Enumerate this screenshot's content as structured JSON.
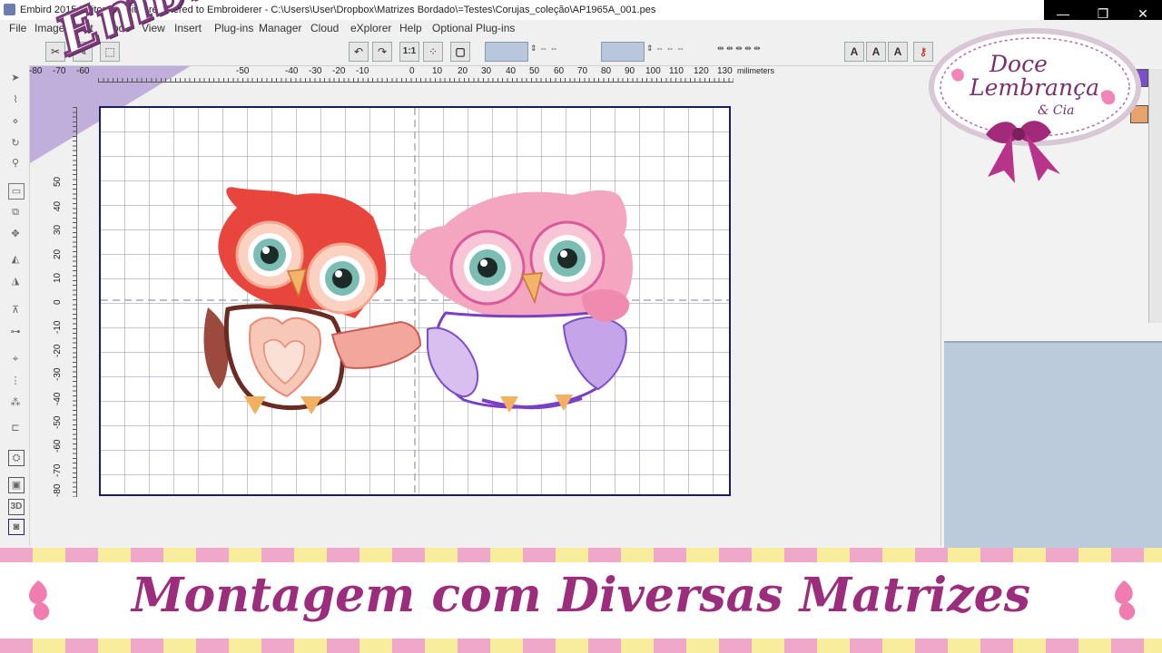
{
  "window": {
    "title": "Embird 2015 Editor (32-bit) - registered to Embroiderer - C:\\Users\\User\\Dropbox\\Matrizes Bordado\\=Testes\\Corujas_coleção\\AP1965A_001.pes",
    "controls": {
      "minimize": "—",
      "maximize": "❐",
      "close": "✕"
    }
  },
  "menu": [
    "File",
    "Image",
    "Edit",
    "Mode",
    "View",
    "Insert",
    "Plug-ins",
    "Manager",
    "Cloud",
    "eXplorer",
    "Help",
    "Optional Plug-ins"
  ],
  "toolbar": {
    "zoom_1to1": "1:1",
    "text_tools": [
      "A",
      "A",
      "A"
    ]
  },
  "ruler": {
    "h_labels": [
      "-80",
      "-70",
      "-60",
      "-50",
      "-40",
      "-30",
      "-20",
      "-10",
      "0",
      "10",
      "20",
      "30",
      "40",
      "50",
      "60",
      "70",
      "80",
      "90",
      "100",
      "110",
      "120",
      "130"
    ],
    "units": "milimeters",
    "v_labels": [
      "50",
      "40",
      "30",
      "20",
      "10",
      "0",
      "-10",
      "-20",
      "-30",
      "-40",
      "-50",
      "-60",
      "-70",
      "-80"
    ]
  },
  "left_tools": {
    "threed": "3D"
  },
  "overlay": {
    "brand_left": "Embird",
    "logo_line1": "Doce",
    "logo_line2": "Lembrança",
    "logo_line3": "& Cia",
    "banner_title": "Montagem com Diversas Matrizes"
  },
  "colors": {
    "canvas_border": "#1a1a6e",
    "owl_red": "#e8453c",
    "owl_pink": "#f4a6c0",
    "banner_text": "#9c2d7c",
    "stripe_pink": "#f0a8c8",
    "stripe_yellow": "#f7ed9c",
    "swatch_purple": "#7a4fc9",
    "swatch_orange": "#e8a26c"
  },
  "icons": [
    "arrow-select-icon",
    "lasso-icon",
    "rotate-icon",
    "zoom-icon",
    "rectangle-select-icon",
    "move-icon",
    "mirror-icon",
    "center-icon",
    "hoop-icon",
    "tag-icon"
  ]
}
